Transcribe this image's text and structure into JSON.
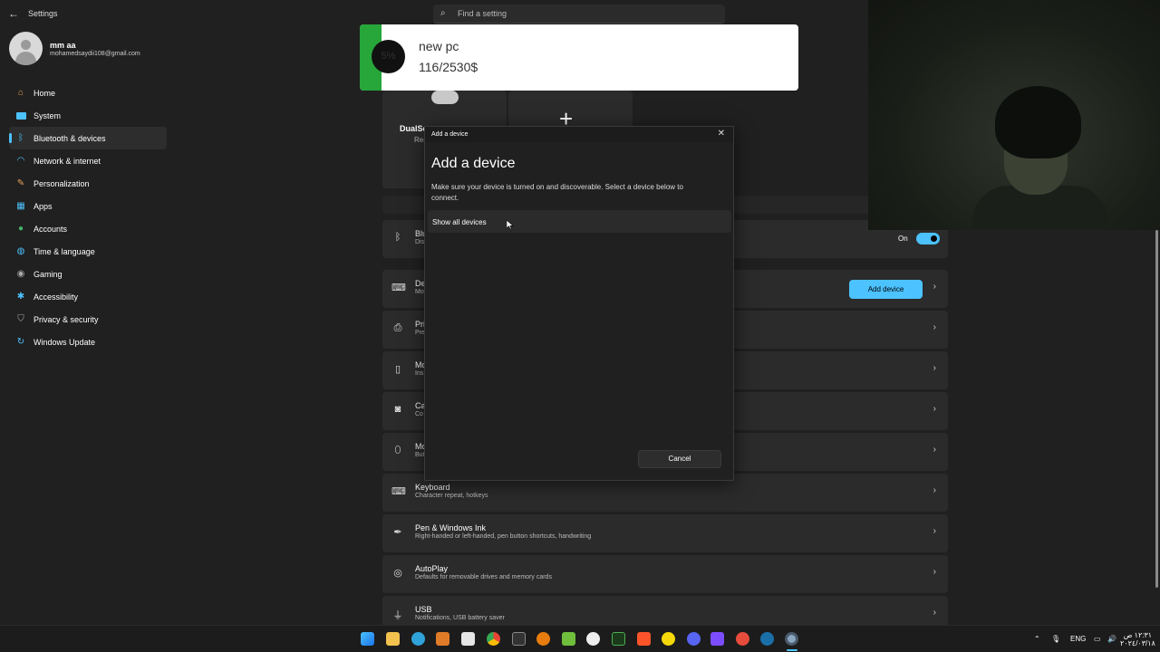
{
  "window": {
    "title": "Settings"
  },
  "search": {
    "placeholder": "Find a setting"
  },
  "profile": {
    "name": "mm aa",
    "email": "mohamedsaydii108@gmail.com"
  },
  "sidebar": {
    "items": [
      {
        "label": "Home",
        "icon": "home-icon",
        "color": "#e8a15a"
      },
      {
        "label": "System",
        "icon": "system-icon",
        "color": "#4cc2ff"
      },
      {
        "label": "Bluetooth & devices",
        "icon": "bluetooth-icon",
        "color": "#4cc2ff",
        "selected": true
      },
      {
        "label": "Network & internet",
        "icon": "wifi-icon",
        "color": "#4cc2ff"
      },
      {
        "label": "Personalization",
        "icon": "brush-icon",
        "color": "#e8a15a"
      },
      {
        "label": "Apps",
        "icon": "apps-icon",
        "color": "#4cc2ff"
      },
      {
        "label": "Accounts",
        "icon": "accounts-icon",
        "color": "#45b36b"
      },
      {
        "label": "Time & language",
        "icon": "globe-icon",
        "color": "#4cc2ff"
      },
      {
        "label": "Gaming",
        "icon": "gaming-icon",
        "color": "#aaaaaa"
      },
      {
        "label": "Accessibility",
        "icon": "accessibility-icon",
        "color": "#4cc2ff"
      },
      {
        "label": "Privacy & security",
        "icon": "shield-icon",
        "color": "#aaaaaa"
      },
      {
        "label": "Windows Update",
        "icon": "update-icon",
        "color": "#4cc2ff"
      }
    ]
  },
  "overlay": {
    "title": "new pc",
    "progress_text": "116/2530$",
    "percent_label": "5%",
    "fraction": 0.05
  },
  "tiles": {
    "controller_name": "DualSe",
    "controller_sub": "Rea"
  },
  "bluetooth_card": {
    "title": "Blu",
    "sub": "Dis",
    "state": "On"
  },
  "devices_card": {
    "title": "De",
    "sub": "Mo",
    "add_label": "Add device"
  },
  "cards": [
    {
      "title": "Pri",
      "sub": "Pre",
      "icon": "printer-icon"
    },
    {
      "title": "Mo",
      "sub": "Ins",
      "icon": "phone-icon"
    },
    {
      "title": "Ca",
      "sub": "Co",
      "icon": "camera-icon"
    },
    {
      "title": "Mo",
      "sub": "But",
      "icon": "mouse-icon"
    },
    {
      "title": "Keyboard",
      "sub": "Character repeat, hotkeys",
      "icon": "keyboard-icon"
    },
    {
      "title": "Pen & Windows Ink",
      "sub": "Right-handed or left-handed, pen button shortcuts, handwriting",
      "icon": "pen-icon"
    },
    {
      "title": "AutoPlay",
      "sub": "Defaults for removable drives and memory cards",
      "icon": "autoplay-icon"
    },
    {
      "title": "USB",
      "sub": "Notifications, USB battery saver",
      "icon": "usb-icon"
    }
  ],
  "dialog": {
    "window_title": "Add a device",
    "heading": "Add a device",
    "description": "Make sure your device is turned on and discoverable. Select a device below to connect.",
    "show_all": "Show all devices",
    "cancel": "Cancel"
  },
  "taskbar": {
    "language": "ENG",
    "time": "١٢:٣١ ص",
    "date": "٢٠٢٤/٠٣/١٨"
  }
}
